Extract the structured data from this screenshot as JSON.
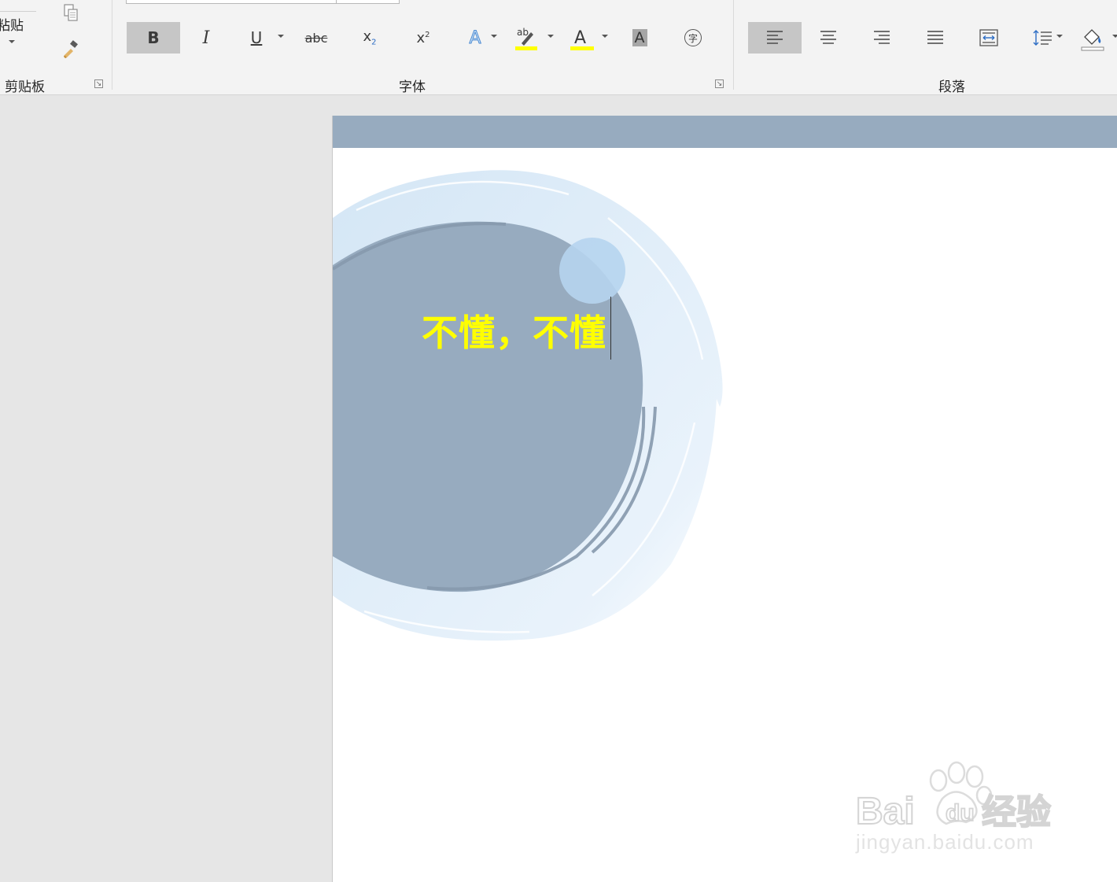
{
  "ribbon": {
    "clipboard": {
      "label": "剪贴板",
      "paste_label": "粘贴",
      "launcher_icon": "dialog-launcher-icon"
    },
    "font": {
      "label": "字体",
      "tools": [
        "bold",
        "italic",
        "underline",
        "strikethrough",
        "subscript",
        "superscript",
        "text-effects",
        "highlight",
        "font-color",
        "character-shading",
        "enclose-characters"
      ],
      "bold_glyph": "B",
      "italic_glyph": "I",
      "underline_glyph": "U",
      "strike_glyph": "abc",
      "subscript_glyph": "x",
      "subscript_small": "2",
      "superscript_glyph": "x",
      "superscript_small": "2",
      "effects_glyph": "A",
      "highlight_glyph": "ab",
      "fontcolor_glyph": "A",
      "shading_glyph": "A",
      "enclose_glyph": "字",
      "highlight_color": "#ffff00",
      "fontcolor_color": "#ffff00"
    },
    "paragraph": {
      "label": "段落",
      "tools": [
        "align-left",
        "center",
        "align-right",
        "justify",
        "distributed",
        "line-spacing",
        "shading"
      ]
    }
  },
  "document": {
    "headline": "不懂，不懂",
    "header_band_color": "#97abbf",
    "circle_color": "#97abbf",
    "ring_color": "#dbe9f6",
    "headline_color": "#ffff00"
  },
  "watermark": {
    "brand_latin": "Bai",
    "brand_du": "du",
    "brand_cn": "经验",
    "url": "jingyan.baidu.com"
  }
}
